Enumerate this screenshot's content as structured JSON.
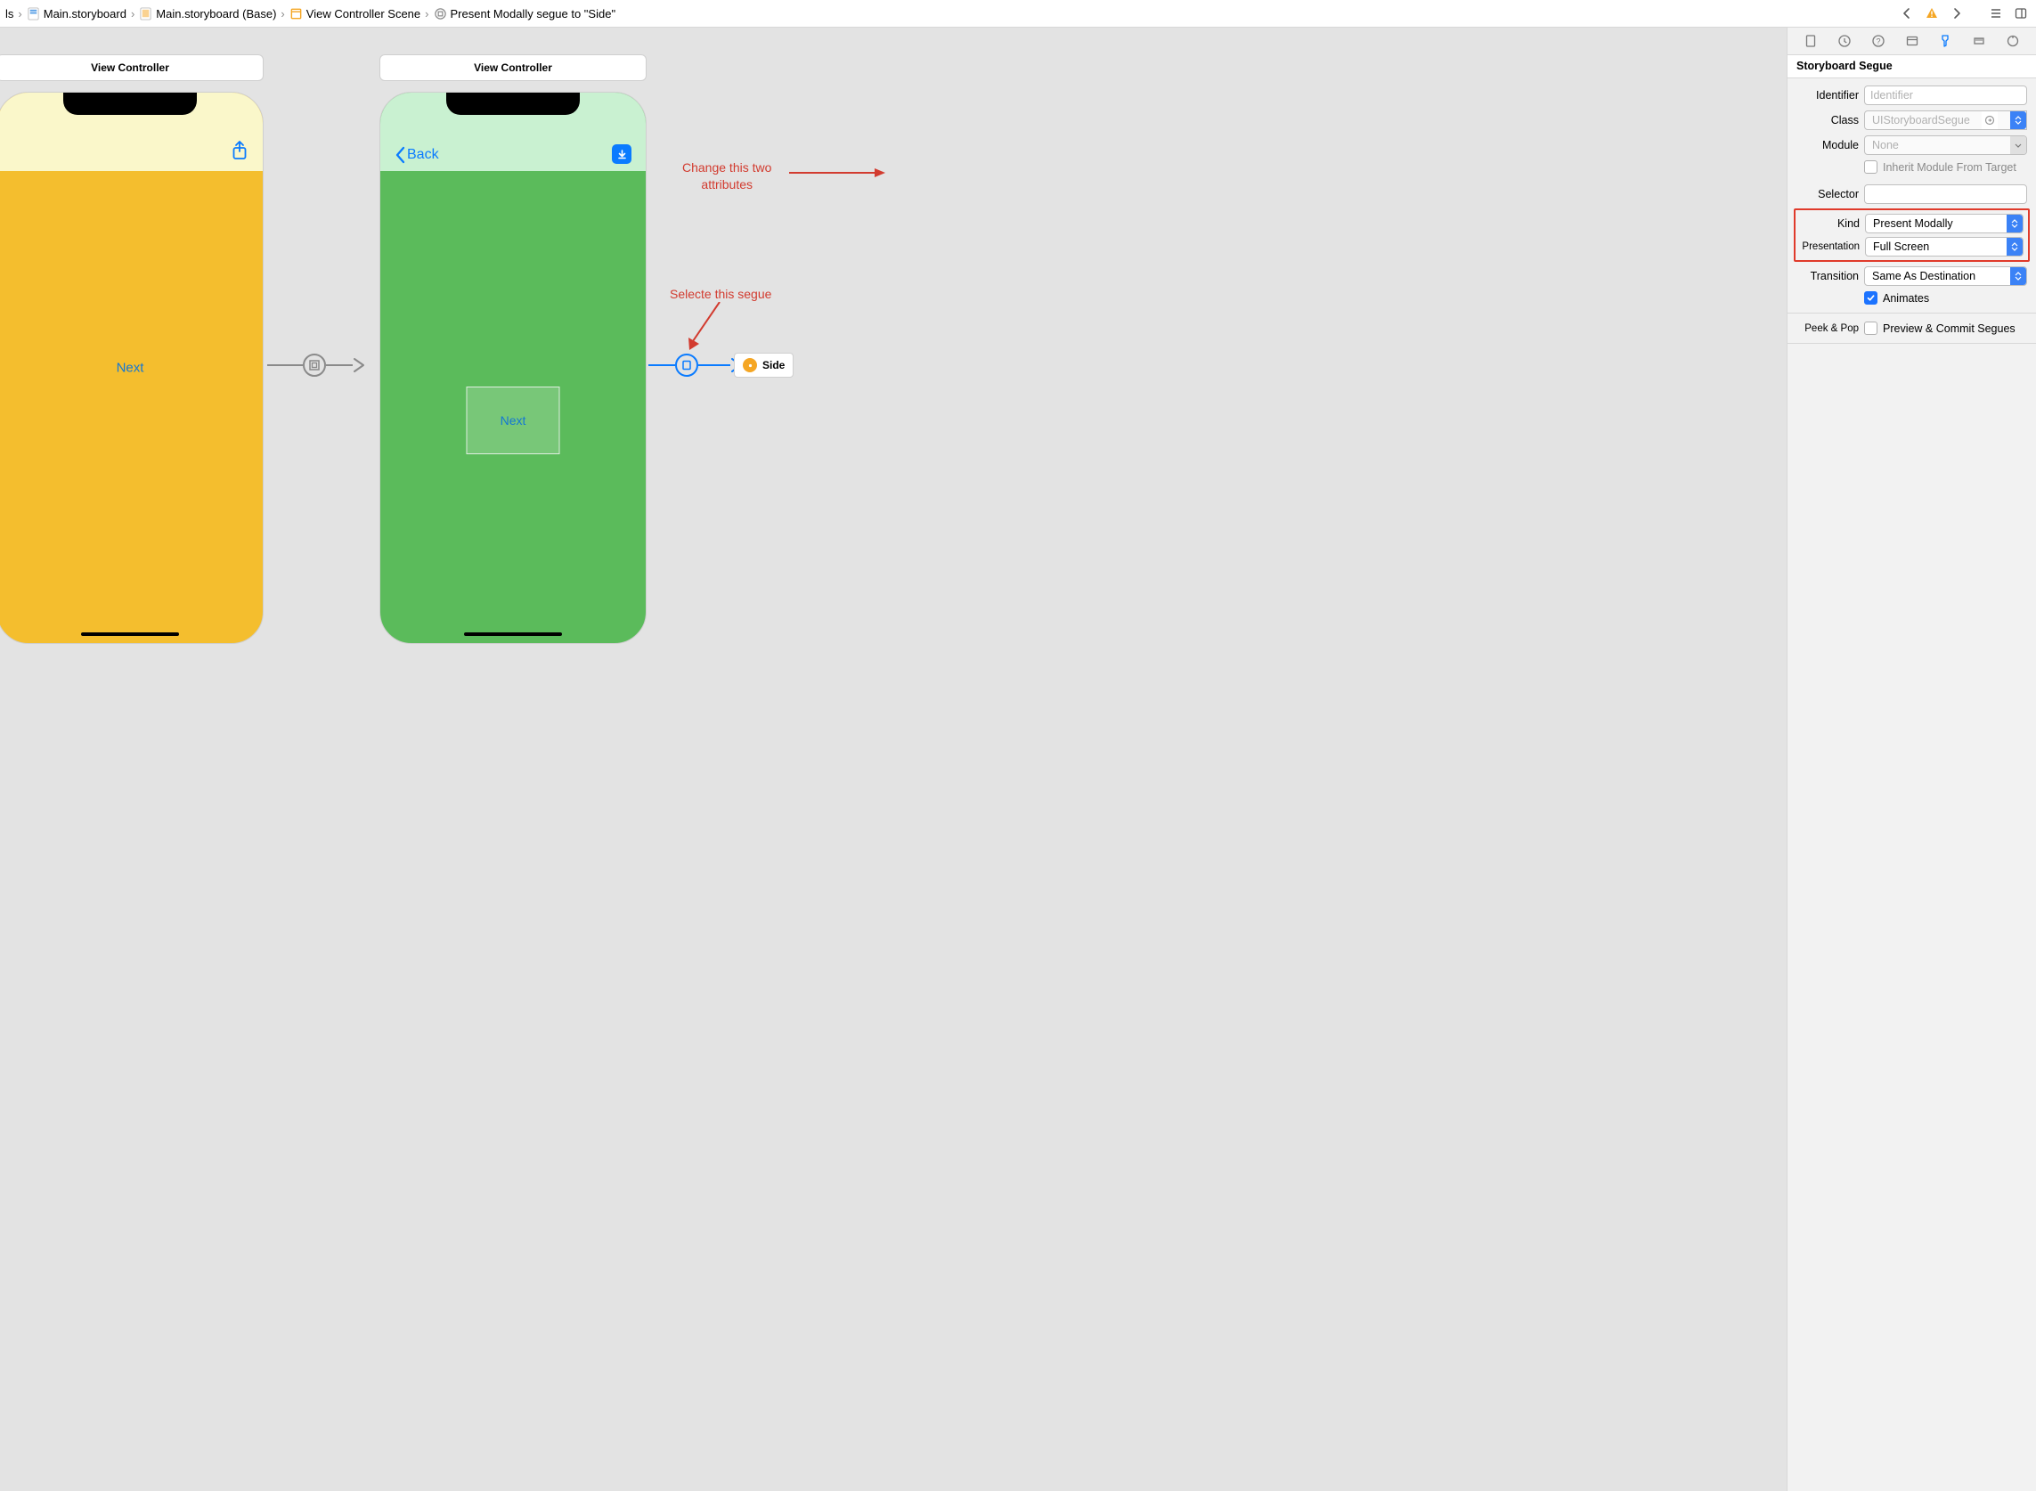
{
  "breadcrumb": {
    "item0": "ls",
    "item1": "Main.storyboard",
    "item2": "Main.storyboard (Base)",
    "item3": "View Controller Scene",
    "item4": "Present Modally segue to \"Side\""
  },
  "canvas": {
    "scene1": {
      "title": "View Controller",
      "button": "Next"
    },
    "scene2": {
      "title": "View Controller",
      "back": "Back",
      "container_button": "Next"
    },
    "side_chip": "Side"
  },
  "annotations": {
    "attributes": "Change this two\nattributes",
    "segue": "Selecte this segue"
  },
  "inspector": {
    "section_title": "Storyboard Segue",
    "labels": {
      "identifier": "Identifier",
      "class": "Class",
      "module": "Module",
      "inherit": "Inherit Module From Target",
      "selector": "Selector",
      "kind": "Kind",
      "presentation": "Presentation",
      "transition": "Transition",
      "animates": "Animates",
      "peekpop": "Peek & Pop",
      "preview": "Preview & Commit Segues"
    },
    "values": {
      "identifier_placeholder": "Identifier",
      "class_placeholder": "UIStoryboardSegue",
      "module_placeholder": "None",
      "kind": "Present Modally",
      "presentation": "Full Screen",
      "transition": "Same As Destination"
    }
  }
}
